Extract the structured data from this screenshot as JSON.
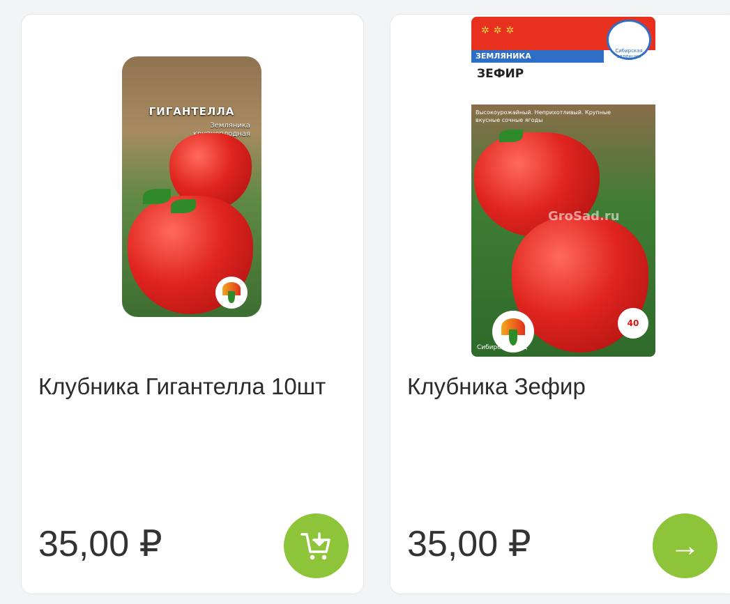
{
  "products": [
    {
      "name": "Клубника Гигантелла 10шт",
      "price": "35,00 ₽",
      "action": "add-to-cart",
      "image": {
        "title": "ГИГАНТЕЛЛА",
        "subtitle": "Земляника крупноплодная"
      }
    },
    {
      "name": "Клубника Зефир",
      "price": "35,00 ₽",
      "action": "go-to-product",
      "action_glyph": "→",
      "image": {
        "band": "ЗЕМЛЯНИКА",
        "title": "ЗЕФИР",
        "description": "Высокоурожайный. Неприхотливый. Крупные вкусные сочные ягоды",
        "watermark": "GroSad.ru",
        "brand": "Сибирский Сад",
        "badge": "40",
        "emblem": "Сибирская селекция"
      }
    }
  ],
  "colors": {
    "accent_green": "#8ec43a",
    "card_bg": "#ffffff",
    "page_bg": "#f2f3f5"
  }
}
